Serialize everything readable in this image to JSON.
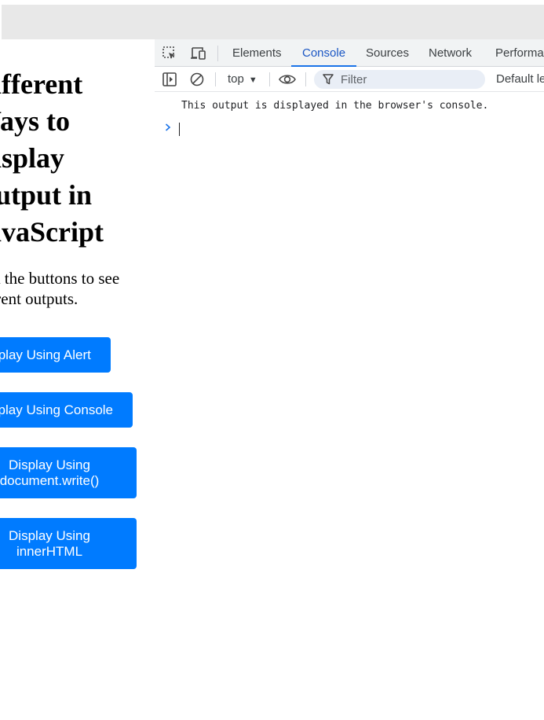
{
  "page": {
    "title": "Different Ways to Display Output in JavaScript",
    "description": "Click the buttons to see different outputs.",
    "buttons": [
      {
        "label": "Display Using Alert"
      },
      {
        "label": "Display Using Console"
      },
      {
        "label": "Display Using document.write()"
      },
      {
        "label": "Display Using innerHTML"
      }
    ]
  },
  "devtools": {
    "tabs": [
      {
        "label": "Elements"
      },
      {
        "label": "Console"
      },
      {
        "label": "Sources"
      },
      {
        "label": "Network"
      },
      {
        "label": "Performa"
      }
    ],
    "active_tab": "Console",
    "toolbar": {
      "context": "top",
      "filter_placeholder": "Filter",
      "levels": "Default le"
    },
    "console": {
      "messages": [
        {
          "text": "This output is displayed in the browser's console."
        }
      ]
    }
  },
  "colors": {
    "button": "#007bff",
    "active_tab": "#1a73e8",
    "chrome_gray": "#e8e8e8"
  },
  "icons": [
    "inspect-element-icon",
    "device-toolbar-icon",
    "sidebar-toggle-icon",
    "clear-console-icon",
    "context-dropdown-icon",
    "live-expression-eye-icon",
    "filter-icon",
    "console-prompt-icon"
  ]
}
